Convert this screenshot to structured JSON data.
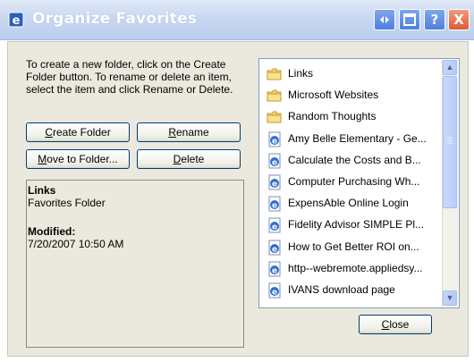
{
  "window": {
    "title": "Organize Favorites",
    "controls": {
      "help_label": "?",
      "close_label": "X"
    }
  },
  "intro_text": "To create a new folder, click on the Create Folder button. To rename or delete an item, select the item and click Rename or Delete.",
  "buttons": {
    "create_folder": {
      "prefix": "",
      "mnemonic": "C",
      "rest": "reate Folder"
    },
    "rename": {
      "prefix": "",
      "mnemonic": "R",
      "rest": "ename"
    },
    "move_to_folder": {
      "prefix": "",
      "mnemonic": "M",
      "rest": "ove to Folder..."
    },
    "delete": {
      "prefix": "",
      "mnemonic": "D",
      "rest": "elete"
    },
    "close": {
      "prefix": "",
      "mnemonic": "C",
      "rest": "lose"
    }
  },
  "info": {
    "name": "Links",
    "type": "Favorites Folder",
    "modified_label": "Modified:",
    "modified_value": "7/20/2007 10:50 AM"
  },
  "favorites": [
    {
      "label": "Links",
      "icon": "folder-icon"
    },
    {
      "label": "Microsoft Websites",
      "icon": "folder-icon"
    },
    {
      "label": "Random Thoughts",
      "icon": "folder-icon"
    },
    {
      "label": "Amy Belle Elementary - Ge...",
      "icon": "ie-page-icon"
    },
    {
      "label": "Calculate the Costs and B...",
      "icon": "ie-page-icon"
    },
    {
      "label": "Computer Purchasing Wh...",
      "icon": "ie-page-icon"
    },
    {
      "label": "ExpensAble Online Login",
      "icon": "ie-page-icon"
    },
    {
      "label": "Fidelity Advisor SIMPLE Pl...",
      "icon": "ie-page-icon"
    },
    {
      "label": "How to Get Better ROI on...",
      "icon": "ie-page-icon"
    },
    {
      "label": "http--webremote.appliedsy...",
      "icon": "ie-page-icon"
    },
    {
      "label": "IVANS download page",
      "icon": "ie-page-icon"
    }
  ],
  "colors": {
    "titlebar": "#c9d8f1",
    "dialog_bg": "#ebe9dd",
    "close_button": "#dd5a35",
    "title_button": "#4f7fe0"
  }
}
